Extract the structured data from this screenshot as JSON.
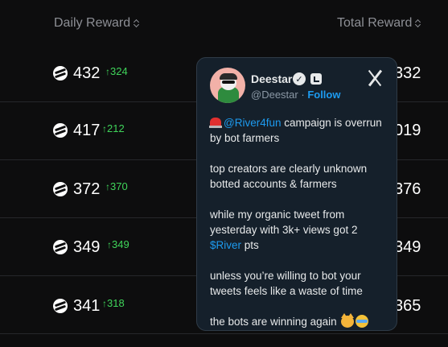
{
  "header": {
    "daily_reward": "Daily Reward",
    "total_reward": "Total Reward"
  },
  "rows": [
    {
      "reward": "432",
      "delta": "324",
      "total": "332"
    },
    {
      "reward": "417",
      "delta": "212",
      "total": "019"
    },
    {
      "reward": "372",
      "delta": "370",
      "total": "376"
    },
    {
      "reward": "349",
      "delta": "349",
      "total": "349"
    },
    {
      "reward": "341",
      "delta": "318",
      "total": "365"
    }
  ],
  "tweet": {
    "name": "Deestar",
    "handle": "@Deestar",
    "separator": "·",
    "follow": "Follow",
    "mention": "@River4fun",
    "line1_rest": " campaign is overrun by bot farmers",
    "para2": "top creators are clearly unknown botted accounts & farmers",
    "para3_a": "while my organic tweet from yesterday with 3k+ views got 2 ",
    "para3_link": "$River",
    "para3_b": " pts",
    "para4": "unless you’re willing to bot your tweets feels like a waste of time",
    "para5": "the bots are winning again"
  },
  "colors": {
    "background": "#0d0d0e",
    "positive": "#3fd45a",
    "link": "#1d9bf0",
    "card": "#15202b"
  },
  "icons": [
    "sort-icon",
    "river-coin-icon",
    "up-arrow-icon",
    "verified-badge-icon",
    "affiliate-badge-icon",
    "x-logo-icon",
    "siren-emoji-icon",
    "cat-emoji-icon",
    "crying-emoji-icon"
  ]
}
